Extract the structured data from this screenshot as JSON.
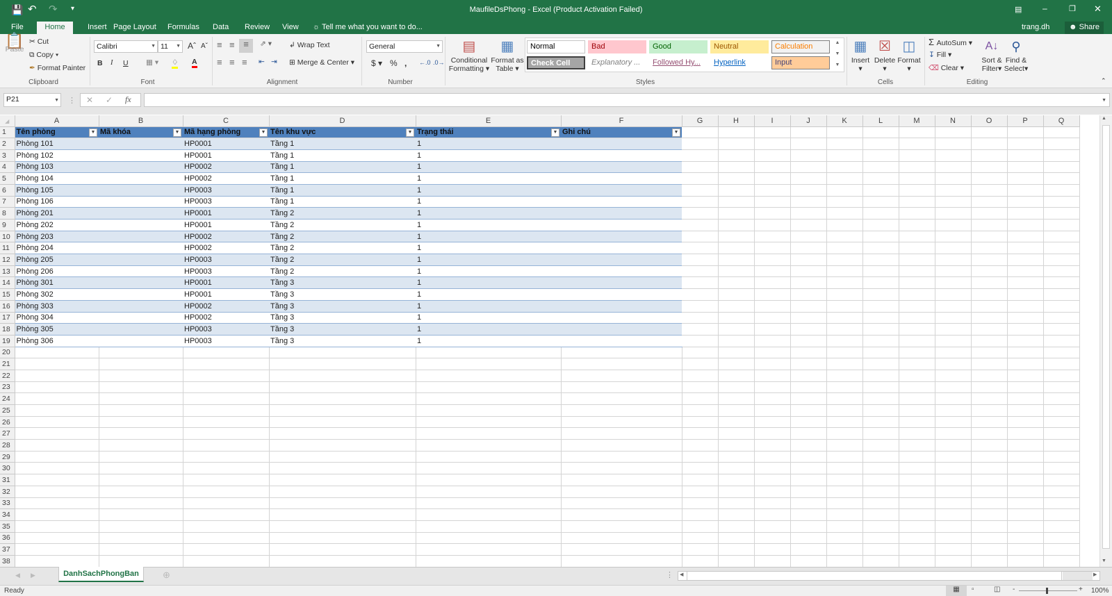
{
  "title": "MaufileDsPhong - Excel (Product Activation Failed)",
  "user": "trang.dh",
  "share_label": "Share",
  "tabs": [
    "File",
    "Home",
    "Insert",
    "Page Layout",
    "Formulas",
    "Data",
    "Review",
    "View"
  ],
  "tell_me": "Tell me what you want to do...",
  "clipboard": {
    "paste": "Paste",
    "cut": "Cut",
    "copy": "Copy",
    "format_painter": "Format Painter",
    "label": "Clipboard"
  },
  "font": {
    "name": "Calibri",
    "size": "11",
    "bold": "B",
    "italic": "I",
    "underline": "U",
    "label": "Font"
  },
  "alignment": {
    "wrap": "Wrap Text",
    "merge": "Merge & Center",
    "label": "Alignment"
  },
  "number": {
    "format": "General",
    "currency": "$",
    "percent": "%",
    "comma": ",",
    "label": "Number"
  },
  "styles": {
    "conditional": "Conditional",
    "conditional2": "Formatting",
    "format_table": "Format as",
    "format_table2": "Table",
    "cells": [
      {
        "label": "Normal",
        "bg": "#ffffff",
        "color": "#000000",
        "border": "#c6c6c6"
      },
      {
        "label": "Bad",
        "bg": "#ffc7ce",
        "color": "#9c0006",
        "border": "transparent"
      },
      {
        "label": "Good",
        "bg": "#c6efce",
        "color": "#006100",
        "border": "transparent"
      },
      {
        "label": "Neutral",
        "bg": "#ffeb9c",
        "color": "#9c5700",
        "border": "transparent"
      },
      {
        "label": "Calculation",
        "bg": "#f2f2f2",
        "color": "#fa7d00",
        "border": "#7f7f7f"
      },
      {
        "label": "Check Cell",
        "bg": "#a5a5a5",
        "color": "#ffffff",
        "border": "#3f3f3f"
      },
      {
        "label": "Explanatory ...",
        "bg": "#ffffff",
        "color": "#7f7f7f",
        "border": "transparent"
      },
      {
        "label": "Followed Hy...",
        "bg": "#ffffff",
        "color": "#954f72",
        "border": "transparent"
      },
      {
        "label": "Hyperlink",
        "bg": "#ffffff",
        "color": "#0563c1",
        "border": "transparent"
      },
      {
        "label": "Input",
        "bg": "#ffcc99",
        "color": "#3f3f76",
        "border": "#7f7f7f"
      }
    ],
    "label": "Styles"
  },
  "cells_group": {
    "insert": "Insert",
    "delete": "Delete",
    "format": "Format",
    "label": "Cells"
  },
  "editing": {
    "autosum": "AutoSum",
    "fill": "Fill",
    "clear": "Clear",
    "sort": "Sort &",
    "sort2": "Filter",
    "find": "Find &",
    "find2": "Select",
    "label": "Editing"
  },
  "name_box": "P21",
  "formula": "",
  "fx": "fx",
  "columns": [
    "A",
    "B",
    "C",
    "D",
    "E",
    "F",
    "G",
    "H",
    "I",
    "J",
    "K",
    "L",
    "M",
    "N",
    "O",
    "P",
    "Q"
  ],
  "table_headers": [
    "Tên phòng",
    "Mã khóa",
    "Mã hạng phòng",
    "Tên khu vực",
    "Trạng thái",
    "Ghi chú"
  ],
  "table_rows": [
    [
      "Phòng 101",
      "",
      "HP0001",
      "Tầng 1",
      "1",
      ""
    ],
    [
      "Phòng 102",
      "",
      "HP0001",
      "Tầng 1",
      "1",
      ""
    ],
    [
      "Phòng 103",
      "",
      "HP0002",
      "Tầng 1",
      "1",
      ""
    ],
    [
      "Phòng 104",
      "",
      "HP0002",
      "Tầng 1",
      "1",
      ""
    ],
    [
      "Phòng 105",
      "",
      "HP0003",
      "Tầng 1",
      "1",
      ""
    ],
    [
      "Phòng 106",
      "",
      "HP0003",
      "Tầng 1",
      "1",
      ""
    ],
    [
      "Phòng 201",
      "",
      "HP0001",
      "Tầng 2",
      "1",
      ""
    ],
    [
      "Phòng 202",
      "",
      "HP0001",
      "Tầng 2",
      "1",
      ""
    ],
    [
      "Phòng 203",
      "",
      "HP0002",
      "Tầng 2",
      "1",
      ""
    ],
    [
      "Phòng 204",
      "",
      "HP0002",
      "Tầng 2",
      "1",
      ""
    ],
    [
      "Phòng 205",
      "",
      "HP0003",
      "Tầng 2",
      "1",
      ""
    ],
    [
      "Phòng 206",
      "",
      "HP0003",
      "Tầng 2",
      "1",
      ""
    ],
    [
      "Phòng 301",
      "",
      "HP0001",
      "Tầng 3",
      "1",
      ""
    ],
    [
      "Phòng 302",
      "",
      "HP0001",
      "Tầng 3",
      "1",
      ""
    ],
    [
      "Phòng 303",
      "",
      "HP0002",
      "Tầng 3",
      "1",
      ""
    ],
    [
      "Phòng 304",
      "",
      "HP0002",
      "Tầng 3",
      "1",
      ""
    ],
    [
      "Phòng 305",
      "",
      "HP0003",
      "Tầng 3",
      "1",
      ""
    ],
    [
      "Phòng 306",
      "",
      "HP0003",
      "Tầng 3",
      "1",
      ""
    ]
  ],
  "visible_row_count": 38,
  "sheet_tab": "DanhSachPhongBan",
  "status": "Ready",
  "zoom": "100%",
  "colors": {
    "accent": "#217346",
    "table_header": "#4f81bd",
    "table_band": "#dce6f1"
  }
}
